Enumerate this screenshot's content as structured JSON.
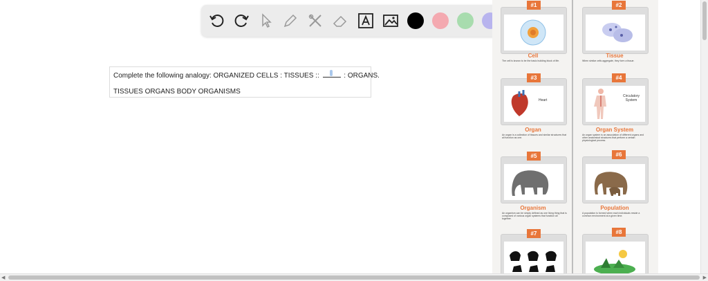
{
  "toolbar": {
    "tools": [
      {
        "name": "undo-icon"
      },
      {
        "name": "redo-icon"
      },
      {
        "name": "pointer-icon"
      },
      {
        "name": "pencil-icon"
      },
      {
        "name": "tools-icon"
      },
      {
        "name": "eraser-icon"
      },
      {
        "name": "text-icon"
      },
      {
        "name": "image-icon"
      }
    ],
    "colors": [
      "#000000",
      "#f4a9b0",
      "#a8dcae",
      "#b8b4ee"
    ]
  },
  "question": {
    "prompt_before": "Complete the following analogy: ORGANIZED CELLS : TISSUES :: ",
    "prompt_after": " : ORGANS.",
    "answers": "TISSUES ORGANS BODY ORGANISMS"
  },
  "infographic": {
    "cards": [
      {
        "num": "#1",
        "title": "Cell",
        "desc": "The cell is known to be the basic building block of life.",
        "label": ""
      },
      {
        "num": "#2",
        "title": "Tissue",
        "desc": "When similar cells aggregate, they form a tissue.",
        "label": ""
      },
      {
        "num": "#3",
        "title": "Organ",
        "desc": "An organ is a collection of tissues and similar structures that all function as one.",
        "label": "Heart"
      },
      {
        "num": "#4",
        "title": "Organ System",
        "desc": "An organ system is an association of different organs and other anatomical structures that perform a certain physiological process.",
        "label": "Circulatory System"
      },
      {
        "num": "#5",
        "title": "Organism",
        "desc": "An organism can be simply defined as one living thing that is composed of various organ systems that function all together.",
        "label": ""
      },
      {
        "num": "#6",
        "title": "Population",
        "desc": "A population is formed when each individuals reside a common environment at a given time.",
        "label": ""
      },
      {
        "num": "#7",
        "title": "",
        "desc": "",
        "label": ""
      },
      {
        "num": "#8",
        "title": "",
        "desc": "",
        "label": ""
      }
    ],
    "accent_color": "#e8763a"
  }
}
